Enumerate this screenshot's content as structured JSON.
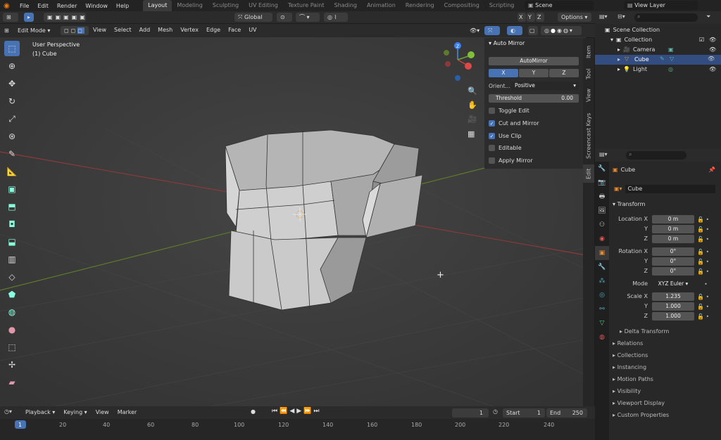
{
  "menu": [
    "File",
    "Edit",
    "Render",
    "Window",
    "Help"
  ],
  "workspaces": [
    "Layout",
    "Modeling",
    "Sculpting",
    "UV Editing",
    "Texture Paint",
    "Shading",
    "Animation",
    "Rendering",
    "Compositing",
    "Scripting"
  ],
  "active_workspace": "Layout",
  "scene": {
    "name": "Scene",
    "view_layer": "View Layer"
  },
  "header": {
    "transform_orientation": "Global",
    "axes": [
      "X",
      "Y",
      "Z"
    ],
    "options": "Options"
  },
  "editor_header": {
    "mode": "Edit Mode",
    "menus": [
      "View",
      "Select",
      "Add",
      "Mesh",
      "Vertex",
      "Edge",
      "Face",
      "UV"
    ]
  },
  "viewport": {
    "perspective": "User Perspective",
    "object": "(1) Cube"
  },
  "npanel": {
    "title": "Auto Mirror",
    "auto_button": "AutoMirror",
    "axis": [
      "X",
      "Y",
      "Z"
    ],
    "active_axis": "X",
    "orient_label": "Orient...",
    "orient_value": "Positive",
    "threshold_label": "Threshold",
    "threshold_value": "0.00",
    "options": [
      {
        "label": "Toggle Edit",
        "checked": false
      },
      {
        "label": "Cut and Mirror",
        "checked": true
      },
      {
        "label": "Use Clip",
        "checked": true
      },
      {
        "label": "Editable",
        "checked": false
      },
      {
        "label": "Apply Mirror",
        "checked": false
      }
    ],
    "tabs": [
      "Item",
      "Tool",
      "View",
      "Screencast Keys",
      "Edit"
    ],
    "active_tab": "Edit"
  },
  "outliner": {
    "root": "Scene Collection",
    "collection": "Collection",
    "items": [
      "Camera",
      "Cube",
      "Light"
    ],
    "selected": "Cube"
  },
  "properties": {
    "object_name": "Cube",
    "data_name": "Cube",
    "transform_title": "Transform",
    "location_label": "Location X",
    "rotation_label": "Rotation X",
    "scale_label": "Scale X",
    "axis_y": "Y",
    "axis_z": "Z",
    "location": [
      "0 m",
      "0 m",
      "0 m"
    ],
    "rotation": [
      "0°",
      "0°",
      "0°"
    ],
    "mode_label": "Mode",
    "mode_value": "XYZ Euler",
    "scale": [
      "1.235",
      "1.000",
      "1.000"
    ],
    "delta": "Delta Transform",
    "sections": [
      "Relations",
      "Collections",
      "Instancing",
      "Motion Paths",
      "Visibility",
      "Viewport Display",
      "Custom Properties"
    ]
  },
  "timeline": {
    "menus": [
      "Playback",
      "Keying",
      "View",
      "Marker"
    ],
    "current_frame": "1",
    "start_label": "Start",
    "start": "1",
    "end_label": "End",
    "end": "250",
    "ruler": [
      "1",
      "20",
      "40",
      "60",
      "80",
      "100",
      "120",
      "140",
      "160",
      "180",
      "200",
      "220",
      "240"
    ]
  },
  "colors": {
    "accent": "#4772b3",
    "x_axis": "#c0392b",
    "y_axis": "#6b8e23",
    "cube_face": "#c8c8c8"
  }
}
